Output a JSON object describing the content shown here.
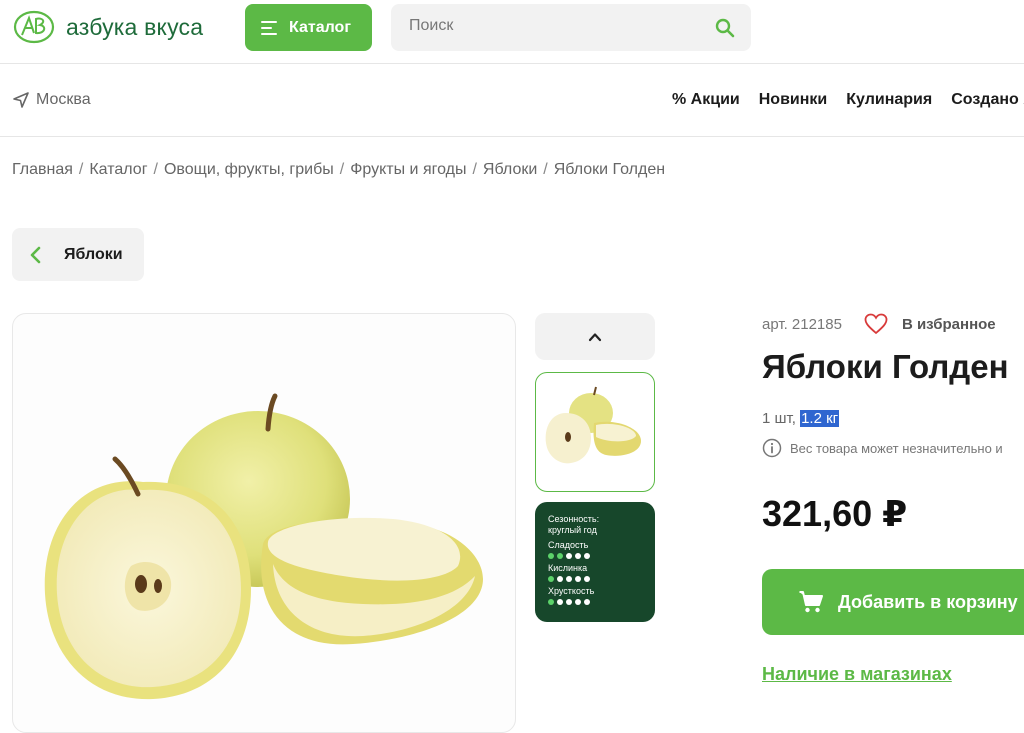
{
  "header": {
    "logo_text": "азбука вкуса",
    "catalog_label": "Каталог",
    "search_placeholder": "Поиск"
  },
  "nav": {
    "city": "Москва",
    "links": [
      "% Акции",
      "Новинки",
      "Кулинария",
      "Создано А"
    ]
  },
  "breadcrumb": [
    "Главная",
    "Каталог",
    "Овощи, фрукты, грибы",
    "Фрукты и ягоды",
    "Яблоки",
    "Яблоки Голден"
  ],
  "back": {
    "label": "Яблоки"
  },
  "product": {
    "article": "арт. 212185",
    "favorite_label": "В избранное",
    "title": "Яблоки Голден",
    "qty_prefix": "1 шт,",
    "weight": "1.2 кг",
    "weight_note": "Вес товара может незначительно и",
    "price": "321,60 ₽",
    "add_to_cart": "Добавить в корзину",
    "availability_link": "Наличие в магазинах"
  },
  "info_card": {
    "season_label": "Сезонность:",
    "season_value": "круглый год",
    "sweetness": {
      "label": "Сладость",
      "level": 2,
      "max": 5
    },
    "acidity": {
      "label": "Кислинка",
      "level": 1,
      "max": 5
    },
    "crunch": {
      "label": "Хрусткость",
      "level": 1,
      "max": 5
    }
  },
  "colors": {
    "accent": "#5cb946",
    "brand_green": "#1e6b3a",
    "card_dark": "#17472b"
  }
}
